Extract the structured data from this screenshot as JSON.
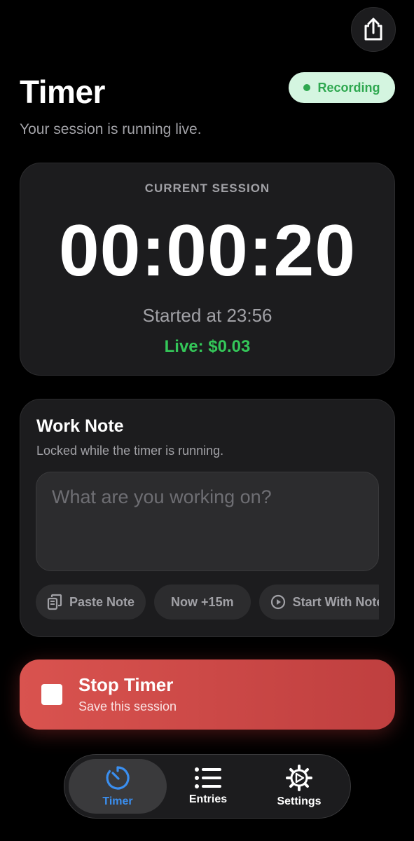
{
  "header": {
    "title": "Timer",
    "subtitle": "Your session is running live.",
    "share_icon": "share-icon",
    "status_badge": {
      "label": "Recording",
      "color": "#2ea84f",
      "background": "#d4f5e0"
    }
  },
  "session": {
    "label": "CURRENT SESSION",
    "elapsed": "00:00:20",
    "started": "Started at 23:56",
    "live": "Live: $0.03"
  },
  "work_note": {
    "title": "Work Note",
    "subtitle": "Locked while the timer is running.",
    "input_value": "",
    "input_placeholder": "What are you working on?",
    "chips": [
      {
        "label": "Paste Note",
        "icon": "clipboard-icon"
      },
      {
        "label": "Now +15m",
        "icon": ""
      },
      {
        "label": "Start With Note",
        "icon": "play-circle-icon"
      }
    ]
  },
  "stop_button": {
    "title": "Stop Timer",
    "subtitle": "Save this session",
    "icon": "stop-square-icon",
    "color": "#d9534f"
  },
  "tab_bar": {
    "active": "Timer",
    "accent": "#3a8ff0",
    "tabs": [
      {
        "label": "Timer",
        "icon": "timer-icon"
      },
      {
        "label": "Entries",
        "icon": "list-icon"
      },
      {
        "label": "Settings",
        "icon": "gear-icon"
      }
    ]
  }
}
